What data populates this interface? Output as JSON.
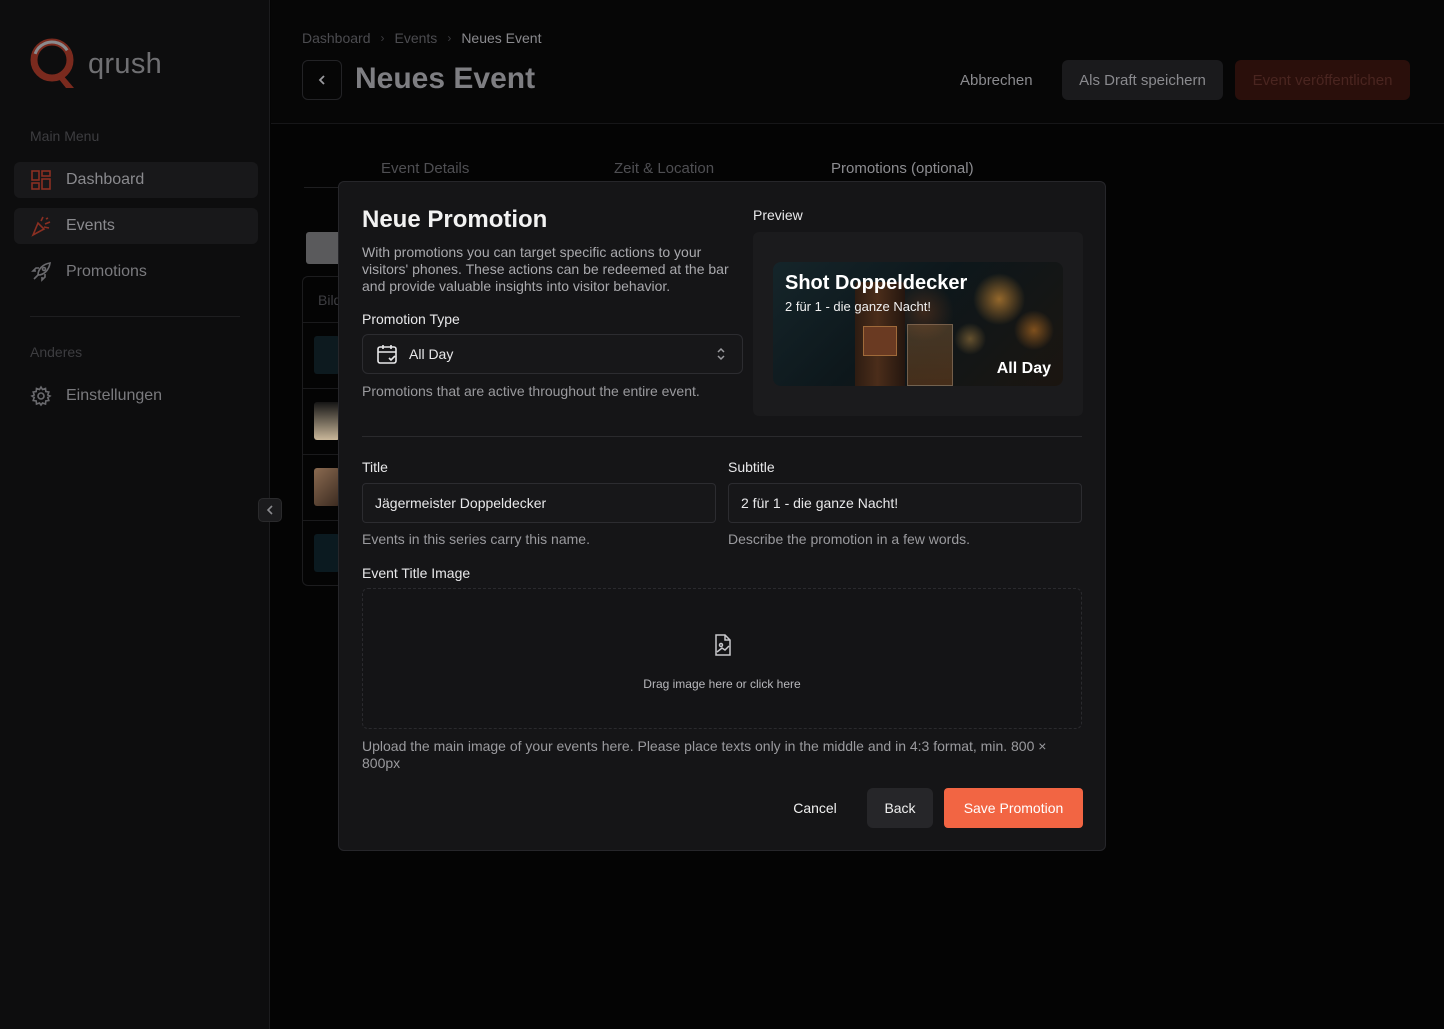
{
  "sidebar": {
    "logo_text": "qrush",
    "main_menu_label": "Main Menu",
    "items": [
      {
        "label": "Dashboard",
        "icon": "dashboard-grid-icon"
      },
      {
        "label": "Events",
        "icon": "party-popper-icon"
      },
      {
        "label": "Promotions",
        "icon": "rocket-icon"
      }
    ],
    "other_label": "Anderes",
    "settings_label": "Einstellungen"
  },
  "header": {
    "breadcrumb": [
      "Dashboard",
      "Events",
      "Neues Event"
    ],
    "title": "Neues Event",
    "cancel_label": "Abbrechen",
    "draft_label": "Als Draft speichern",
    "publish_label": "Event veröffentlichen"
  },
  "steps": [
    "Event Details",
    "Zeit & Location",
    "Promotions (optional)"
  ],
  "background_table": {
    "column": "Bild"
  },
  "modal": {
    "title": "Neue Promotion",
    "description": "With promotions you can target specific actions to your visitors' phones. These actions can be redeemed at the bar and provide valuable insights into visitor behavior.",
    "promotion_type_label": "Promotion Type",
    "promotion_type_value": "All Day",
    "promotion_type_hint": "Promotions that are active throughout the entire event.",
    "preview_label": "Preview",
    "preview": {
      "title": "Shot Doppeldecker",
      "subtitle": "2 für 1 - die ganze Nacht!",
      "badge": "All Day"
    },
    "title_label": "Title",
    "title_value": "Jägermeister Doppeldecker",
    "title_hint": "Events in this series carry this name.",
    "subtitle_label": "Subtitle",
    "subtitle_value": "2 für 1 - die ganze Nacht!",
    "subtitle_hint": "Describe the promotion in a few words.",
    "image_label": "Event Title Image",
    "dropzone_text": "Drag image here or click here",
    "image_hint": "Upload the main image of your events here. Please place texts only in the middle and in 4:3 format, min. 800 × 800px",
    "cancel_label": "Cancel",
    "back_label": "Back",
    "save_label": "Save Promotion"
  },
  "colors": {
    "accent": "#f26543",
    "background": "#040404",
    "modal": "#151517"
  }
}
